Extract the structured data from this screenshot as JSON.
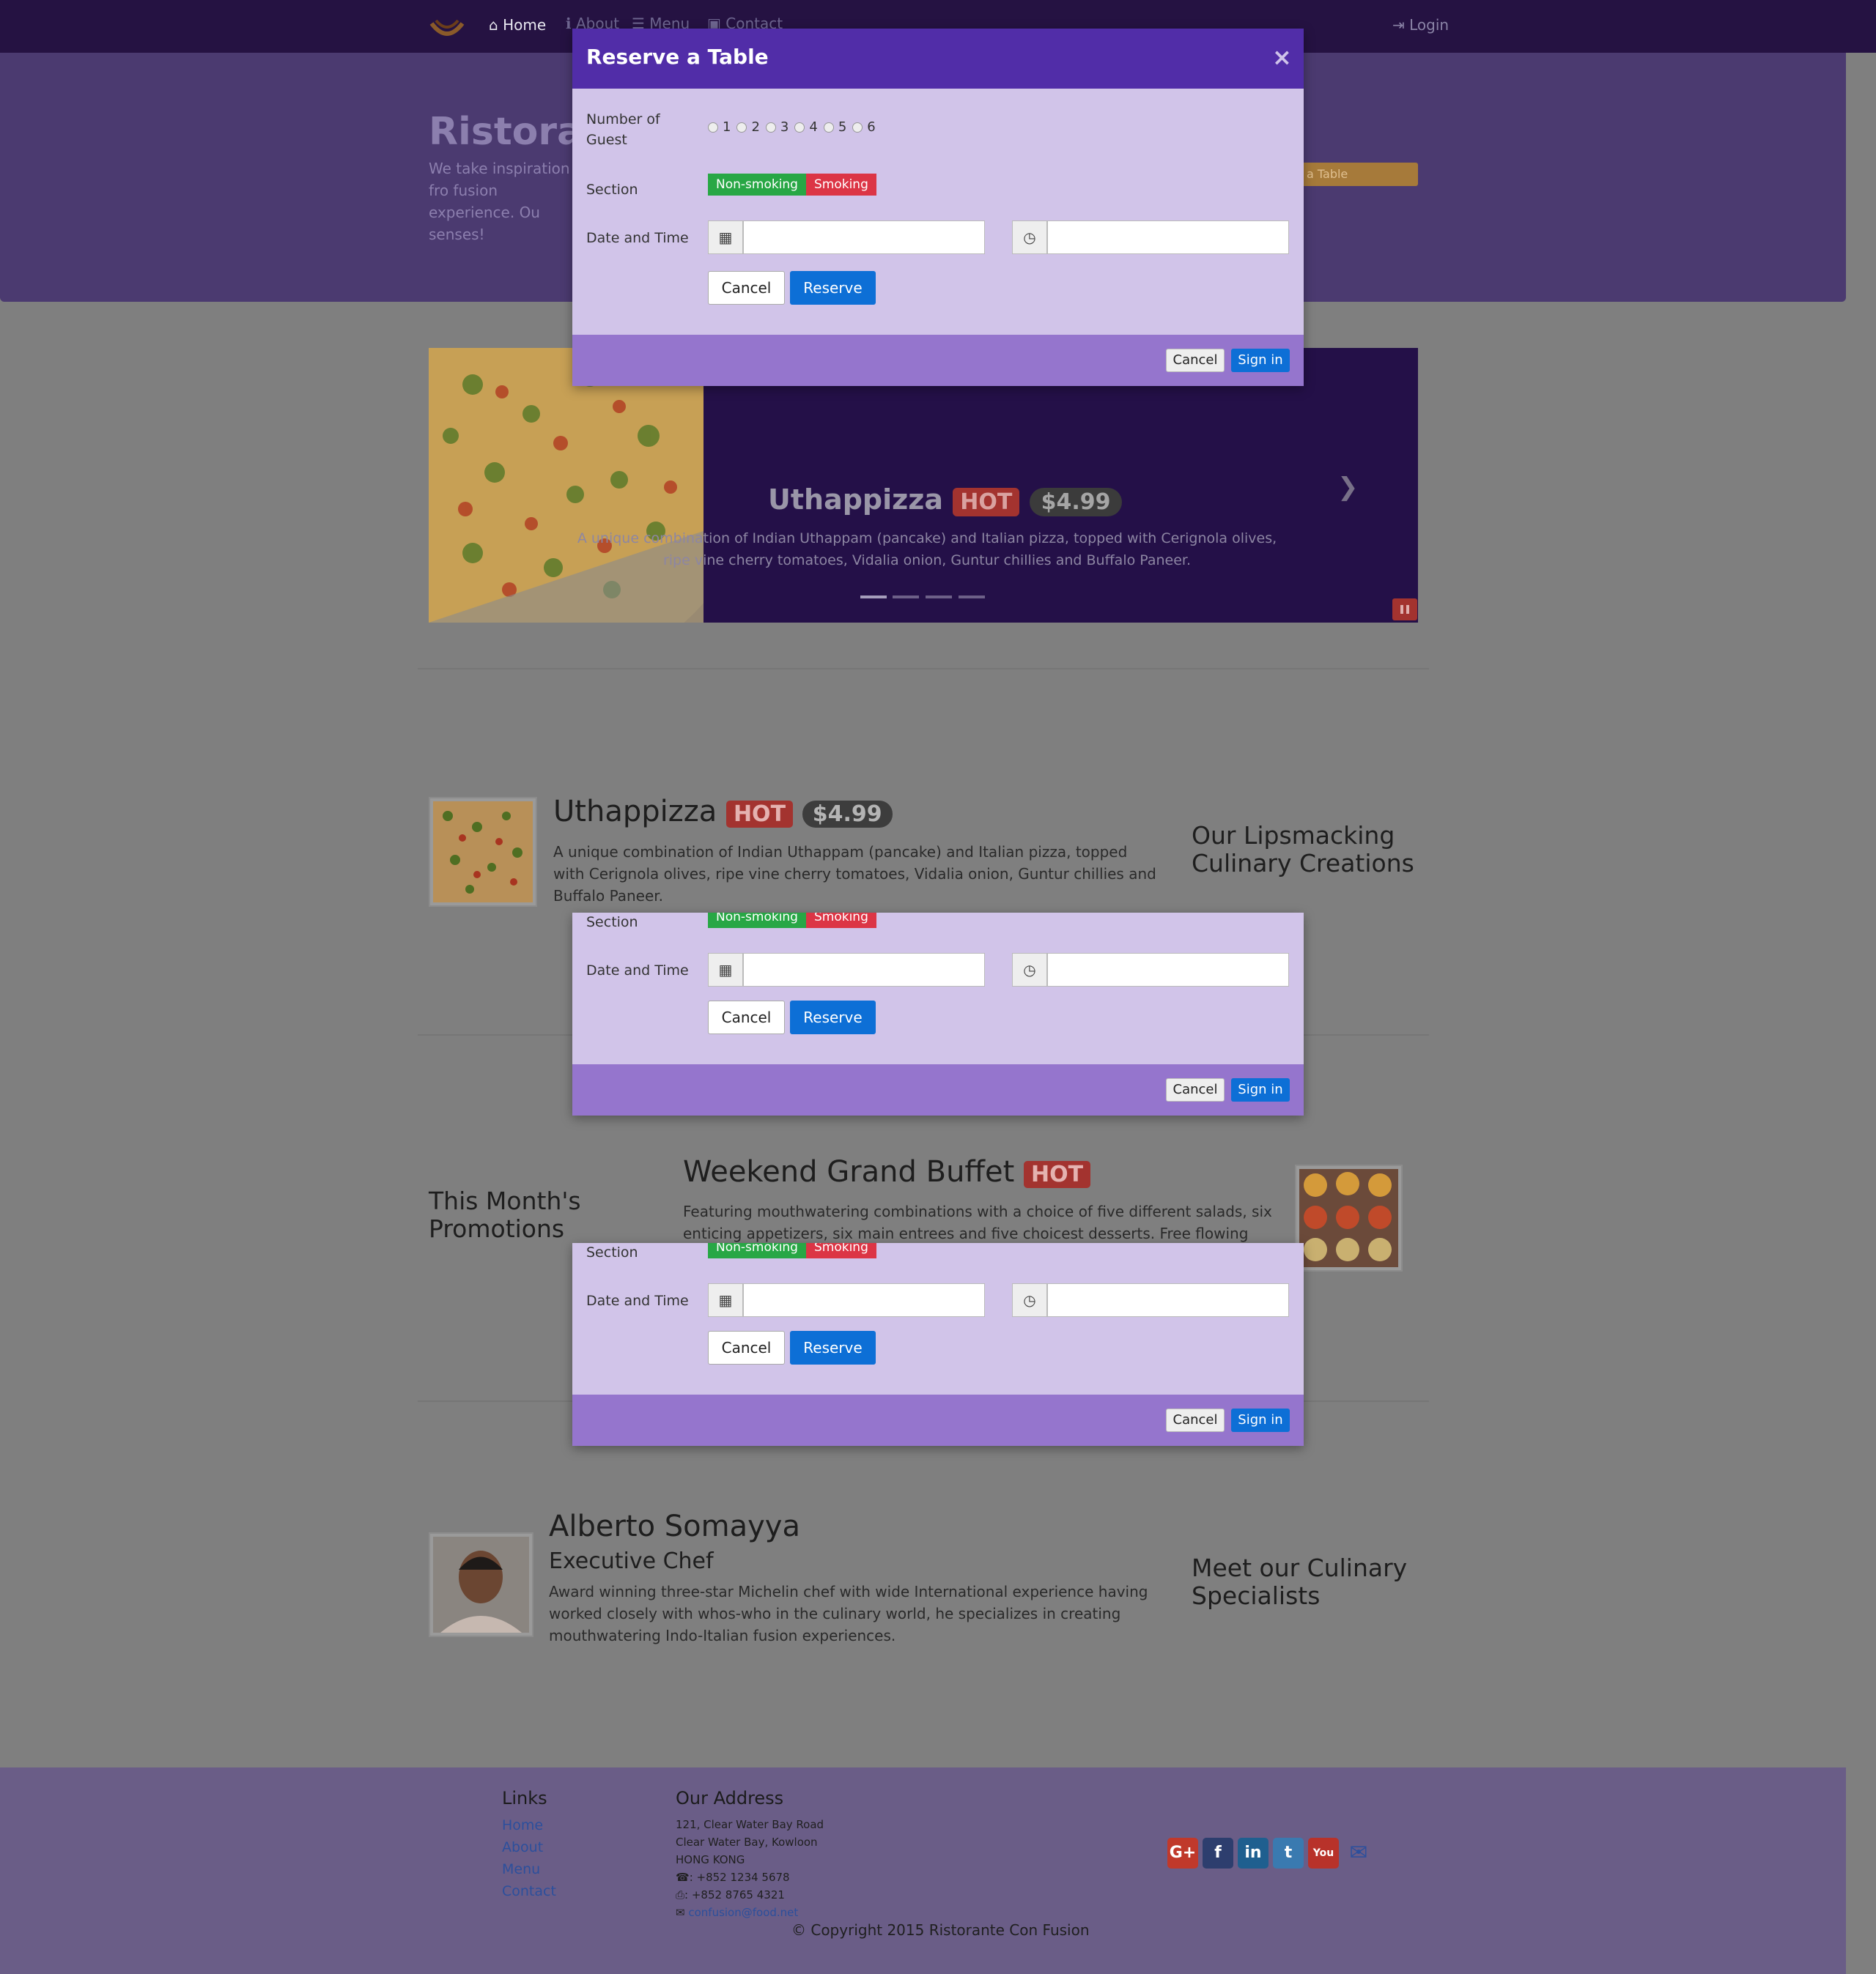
{
  "nav": {
    "home": "Home",
    "about": "About",
    "menu": "Menu",
    "contact": "Contact",
    "login": "Login"
  },
  "jumbotron": {
    "title": "Ristorant",
    "text": "We take inspiration fro fusion experience. Ou senses!",
    "button": "a Table"
  },
  "carousel": {
    "dish": "Uthappizza",
    "badge": "HOT",
    "price": "$4.99",
    "description": "A unique combination of Indian Uthappam (pancake) and Italian pizza, topped with Cerignola olives, ripe vine cherry tomatoes, Vidalia onion, Guntur chillies and Buffalo Paneer."
  },
  "dish": {
    "name": "Uthappizza",
    "badge": "HOT",
    "price": "$4.99",
    "description": "A unique combination of Indian Uthappam (pancake) and Italian pizza, topped with Cerignola olives, ripe vine cherry tomatoes, Vidalia onion, Guntur chillies and Buffalo Paneer.",
    "section_title": "Our Lipsmacking Culinary Creations"
  },
  "promotion": {
    "section_title": "This Month's Promotions",
    "name": "Weekend Grand Buffet",
    "badge": "HOT",
    "description": "Featuring mouthwatering combinations with a choice of five different salads, six enticing appetizers, six main entrees and five choicest desserts. Free flowing bubbly and soft drinks. All"
  },
  "leader": {
    "name": "Alberto Somayya",
    "role": "Executive Chef",
    "description": "Award winning three-star Michelin chef with wide International experience having worked closely with whos-who in the culinary world, he specializes in creating mouthwatering Indo-Italian fusion experiences.",
    "section_title": "Meet our Culinary Specialists"
  },
  "modal": {
    "title": "Reserve a Table",
    "close": "×",
    "guests_label": "Number of Guest",
    "guest_options": [
      "1",
      "2",
      "3",
      "4",
      "5",
      "6"
    ],
    "section_label": "Section",
    "non_smoking": "Non-smoking",
    "smoking": "Smoking",
    "datetime_label": "Date and Time",
    "cancel": "Cancel",
    "reserve": "Reserve",
    "footer_cancel": "Cancel",
    "sign_in": "Sign in"
  },
  "footer": {
    "links_title": "Links",
    "links": [
      "Home",
      "About",
      "Menu",
      "Contact"
    ],
    "address_title": "Our Address",
    "address_lines": [
      "121, Clear Water Bay Road",
      "Clear Water Bay, Kowloon",
      "HONG KONG"
    ],
    "phone": ": +852 1234 5678",
    "fax": ": +852 8765 4321",
    "email": "confusion@food.net",
    "copyright": "© Copyright 2015 Ristorante Con Fusion"
  },
  "social_icons": [
    "google-plus-icon",
    "facebook-icon",
    "linkedin-icon",
    "twitter-icon",
    "youtube-icon",
    "mail-icon"
  ],
  "colors": {
    "navbar": "#251242",
    "primary": "#512da8",
    "modal_body": "#d1c4e9",
    "modal_footer": "#9575cd",
    "btn_primary": "#0d6fd6",
    "success": "#28a745",
    "danger": "#dc3545"
  }
}
